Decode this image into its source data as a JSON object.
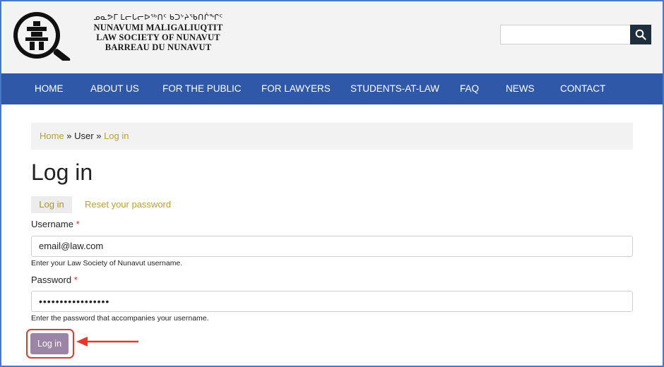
{
  "brand": {
    "syllabics": "ᓄᓇᕗᒥ ᒪᓕᒐᓕᐅᖅᑎᑦ ᑲᑐᔾᔨᖃᑎᒌᖏᑦ",
    "line1": "NUNAVUMI MALIGALIUQTIT",
    "line2": "LAW SOCIETY OF NUNAVUT",
    "line3": "BARREAU DU NUNAVUT",
    "logo_icon": "inukshuk-magnifier-icon"
  },
  "search": {
    "value": "",
    "placeholder": "",
    "button_icon": "search-icon"
  },
  "nav": {
    "items": [
      {
        "label": "HOME"
      },
      {
        "label": "ABOUT US"
      },
      {
        "label": "FOR THE PUBLIC"
      },
      {
        "label": "FOR LAWYERS"
      },
      {
        "label": "STUDENTS-AT-LAW"
      },
      {
        "label": "FAQ"
      },
      {
        "label": "NEWS"
      },
      {
        "label": "CONTACT"
      }
    ]
  },
  "breadcrumb": {
    "home": "Home",
    "sep1": " » ",
    "user": "User",
    "sep2": " » ",
    "current": "Log in"
  },
  "page": {
    "title": "Log in"
  },
  "tabs": {
    "active": "Log in",
    "reset": "Reset your password"
  },
  "form": {
    "username_label": "Username",
    "username_value": "email@law.com",
    "username_help": "Enter your Law Society of Nunavut username.",
    "password_label": "Password",
    "password_value": "•••••••••••••••••",
    "password_help": "Enter the password that accompanies your username.",
    "required_marker": "*",
    "submit_label": "Log in"
  },
  "colors": {
    "nav_bg": "#2f58a9",
    "link": "#b7a133",
    "submit_bg": "#9b84a6",
    "highlight": "#e03a2c",
    "required": "#cc2b2b"
  }
}
